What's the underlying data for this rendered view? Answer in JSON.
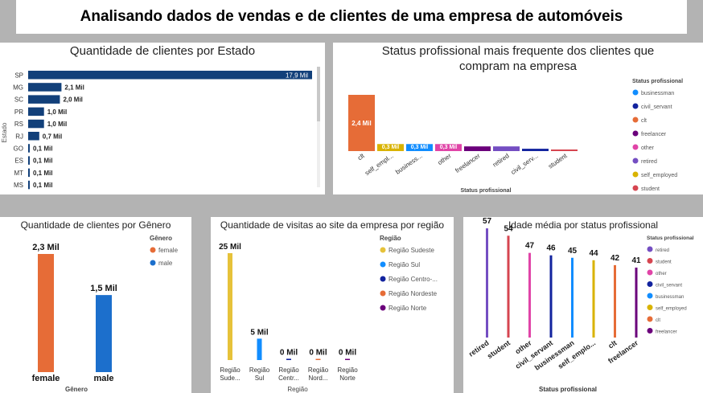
{
  "page_title": "Analisando dados de vendas e de clientes de uma empresa de automóveis",
  "chart_data": [
    {
      "id": "estado",
      "type": "bar",
      "orientation": "horizontal",
      "title": "Quantidade de clientes por Estado",
      "ylabel": "Estado",
      "categories": [
        "SP",
        "MG",
        "SC",
        "PR",
        "RS",
        "RJ",
        "GO",
        "ES",
        "MT",
        "MS"
      ],
      "values": [
        17.9,
        2.1,
        2.0,
        1.0,
        1.0,
        0.7,
        0.1,
        0.1,
        0.1,
        0.1
      ],
      "labels": [
        "17,9 Mil",
        "2,1 Mil",
        "2,0 Mil",
        "1,0 Mil",
        "1,0 Mil",
        "0,7 Mil",
        "0,1 Mil",
        "0,1 Mil",
        "0,1 Mil",
        "0,1 Mil"
      ],
      "color": "#12407a",
      "scrollbar": true
    },
    {
      "id": "status",
      "type": "bar",
      "title": "Status profissional mais frequente dos clientes que compram na empresa",
      "title_lines": [
        "Status profissional mais frequente dos clientes que",
        "compram na empresa"
      ],
      "xlabel": "Status profissional",
      "categories": [
        "clt",
        "self_empl...",
        "business...",
        "other",
        "freelancer",
        "retired",
        "civil_serv...",
        "student"
      ],
      "values": [
        2.4,
        0.3,
        0.3,
        0.3,
        0.2,
        0.2,
        0.1,
        0.0
      ],
      "labels": [
        "2,4 Mil",
        "0,3 Mil",
        "0,3 Mil",
        "0,3 Mil",
        "",
        "",
        "",
        ""
      ],
      "colors": [
        "#e66c37",
        "#d9b300",
        "#118dff",
        "#e044a7",
        "#6b007b",
        "#744ec2",
        "#12239e",
        "#d64550"
      ],
      "legend": {
        "title": "Status profissional",
        "position": "right",
        "items": [
          {
            "name": "businessman",
            "color": "#118dff"
          },
          {
            "name": "civil_servant",
            "color": "#12239e"
          },
          {
            "name": "clt",
            "color": "#e66c37"
          },
          {
            "name": "freelancer",
            "color": "#6b007b"
          },
          {
            "name": "other",
            "color": "#e044a7"
          },
          {
            "name": "retired",
            "color": "#744ec2"
          },
          {
            "name": "self_employed",
            "color": "#d9b300"
          },
          {
            "name": "student",
            "color": "#d64550"
          }
        ]
      }
    },
    {
      "id": "genero",
      "type": "bar",
      "title": "Quantidade de clientes por Gênero",
      "xlabel": "Gênero",
      "categories": [
        "female",
        "male"
      ],
      "values": [
        2.3,
        1.5
      ],
      "labels": [
        "2,3 Mil",
        "1,5 Mil"
      ],
      "colors": [
        "#e66c37",
        "#1c6fcc"
      ],
      "legend": {
        "title": "Gênero",
        "position": "right",
        "items": [
          {
            "name": "female",
            "color": "#e66c37"
          },
          {
            "name": "male",
            "color": "#1c6fcc"
          }
        ]
      }
    },
    {
      "id": "visitas",
      "type": "bar",
      "title": "Quantidade de visitas ao site da empresa por região",
      "xlabel": "Região",
      "categories": [
        "Região Sude...",
        "Região Sul",
        "Região Centr...",
        "Região Nord...",
        "Região Norte"
      ],
      "values": [
        25,
        5,
        0.3,
        0.1,
        0.1
      ],
      "labels": [
        "25 Mil",
        "5 Mil",
        "0 Mil",
        "0 Mil",
        "0 Mil"
      ],
      "colors": [
        "#e6c23a",
        "#118dff",
        "#12239e",
        "#e66c37",
        "#6b007b"
      ],
      "legend": {
        "title": "Região",
        "position": "right",
        "items": [
          {
            "name": "Região Sudeste",
            "color": "#e6c23a"
          },
          {
            "name": "Região Sul",
            "color": "#118dff"
          },
          {
            "name": "Região Centro-...",
            "color": "#12239e"
          },
          {
            "name": "Região Nordeste",
            "color": "#e66c37"
          },
          {
            "name": "Região Norte",
            "color": "#6b007b"
          }
        ]
      }
    },
    {
      "id": "idade",
      "type": "bar",
      "title": "Idade média por status profissional",
      "xlabel": "Status profissional",
      "categories": [
        "retired",
        "student",
        "other",
        "civil_servant",
        "businessman",
        "self_emplo...",
        "clt",
        "freelancer"
      ],
      "values": [
        57,
        54,
        47,
        46,
        45,
        44,
        42,
        41
      ],
      "labels": [
        "57",
        "54",
        "47",
        "46",
        "45",
        "44",
        "42",
        "41"
      ],
      "colors": [
        "#744ec2",
        "#d64550",
        "#e044a7",
        "#12239e",
        "#118dff",
        "#d9b300",
        "#e66c37",
        "#6b007b"
      ],
      "legend": {
        "title": "Status profissional",
        "position": "right",
        "items": [
          {
            "name": "retired",
            "color": "#744ec2"
          },
          {
            "name": "student",
            "color": "#d64550"
          },
          {
            "name": "other",
            "color": "#e044a7"
          },
          {
            "name": "civil_servant",
            "color": "#12239e"
          },
          {
            "name": "businessman",
            "color": "#118dff"
          },
          {
            "name": "self_employed",
            "color": "#d9b300"
          },
          {
            "name": "clt",
            "color": "#e66c37"
          },
          {
            "name": "freelancer",
            "color": "#6b007b"
          }
        ]
      }
    }
  ]
}
